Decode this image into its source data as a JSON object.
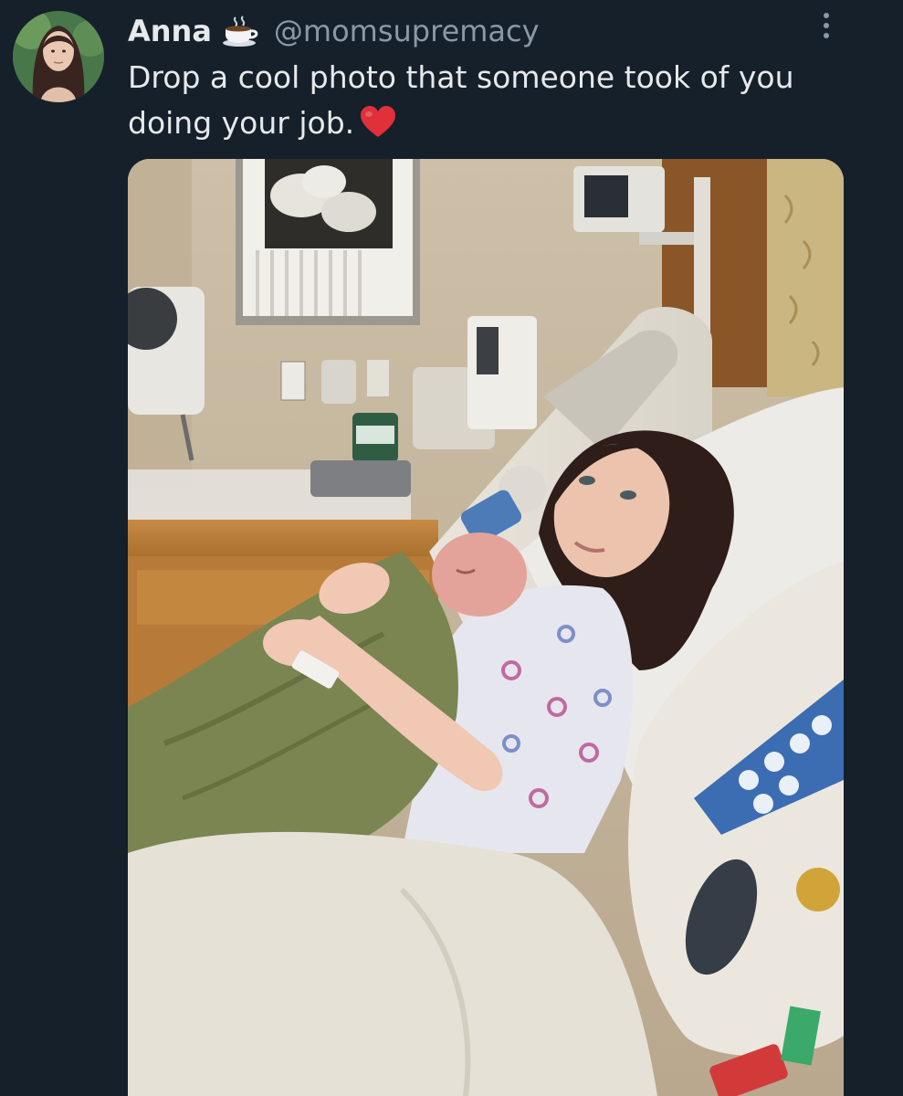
{
  "tweet": {
    "display_name": "Anna",
    "name_emoji": "coffee-icon",
    "handle": "@momsupremacy",
    "text": "Drop a cool photo that someone took of you doing your job.",
    "text_emoji": "heart-icon"
  },
  "colors": {
    "background": "#15202b",
    "text": "#e7e9ea",
    "handle": "#8b98a5",
    "heart": "#e0303a"
  }
}
